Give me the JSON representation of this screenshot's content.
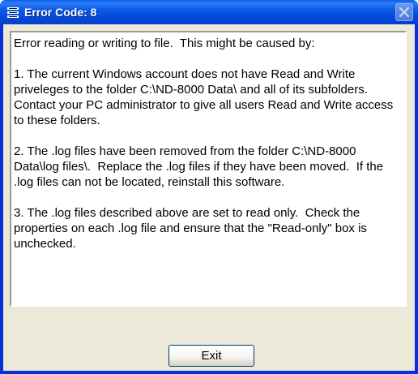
{
  "window": {
    "title": "Error Code: 8"
  },
  "message": {
    "text": "Error reading or writing to file.  This might be caused by:\n\n1. The current Windows account does not have Read and Write priveleges to the folder C:\\ND-8000 Data\\ and all of its subfolders.  Contact your PC administrator to give all users Read and Write access to these folders.\n\n2. The .log files have been removed from the folder C:\\ND-8000 Data\\log files\\.  Replace the .log files if they have been moved.  If the .log files can not be located, reinstall this software.\n\n3. The .log files described above are set to read only.  Check the properties on each .log file and ensure that the \"Read-only\" box is unchecked."
  },
  "buttons": {
    "exit_label": "Exit"
  },
  "icons": {
    "app": "app-icon",
    "close": "close-icon"
  },
  "colors": {
    "titlebar": "#0a5be8",
    "frame": "#0831d9",
    "client_bg": "#ece9d8"
  }
}
